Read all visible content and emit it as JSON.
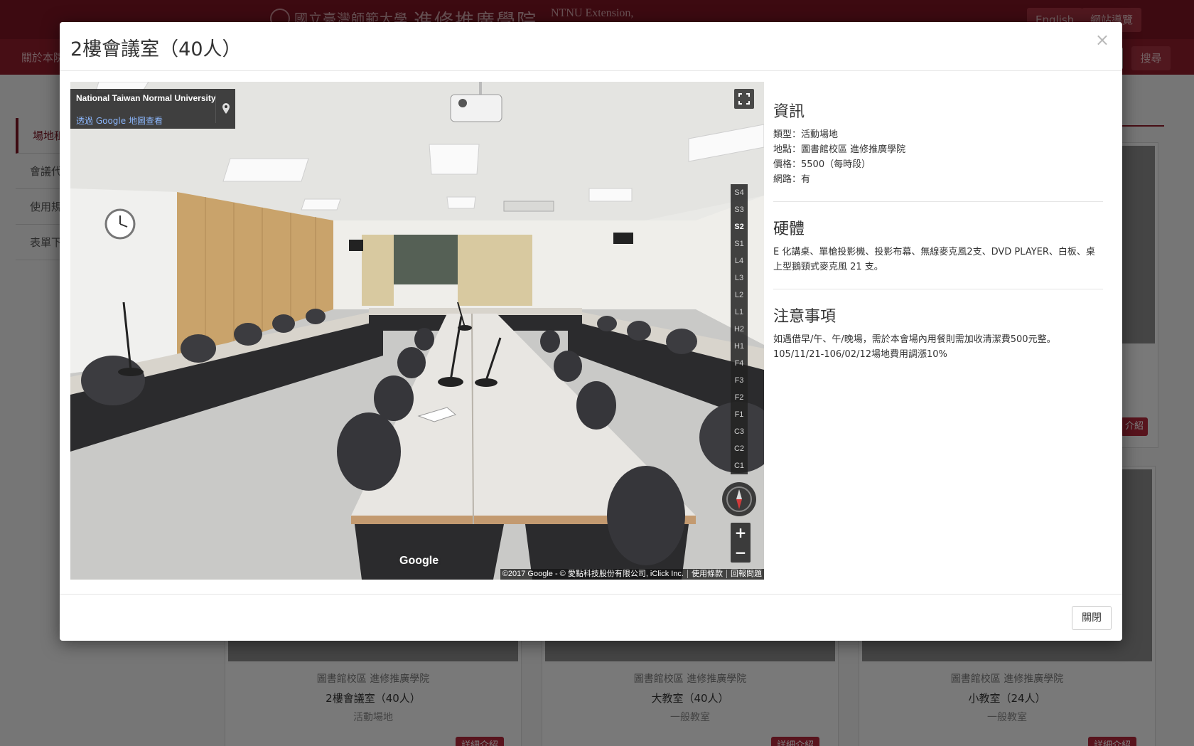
{
  "header": {
    "college_name": "進修推廣學院",
    "college_en": "NTNU Extension,",
    "buttons": [
      "English",
      "網站導覽"
    ]
  },
  "navbar": {
    "first_item": "關於本院",
    "search_label": "搜尋"
  },
  "sidebar": {
    "items": [
      {
        "label": "場地租借"
      },
      {
        "label": "會議代辦"
      },
      {
        "label": "使用規則"
      },
      {
        "label": "表單下載"
      }
    ]
  },
  "cards": [
    {
      "campus": "圖書館校區 進修推廣學院",
      "name": "2樓會議室（40人）",
      "type": "活動場地",
      "detail": "詳細介紹"
    },
    {
      "campus": "圖書館校區 進修推廣學院",
      "name": "大教室（40人）",
      "type": "一般教室",
      "detail": "詳細介紹"
    },
    {
      "campus": "圖書館校區 進修推廣學院",
      "name": "小教室（24人）",
      "type": "一般教室",
      "detail": "詳細介紹"
    }
  ],
  "upper_card_detail": "介紹",
  "modal": {
    "title": "2樓會議室（40人）",
    "close_symbol": "×",
    "close_button": "關閉"
  },
  "streetview": {
    "place_name": "National Taiwan Normal University",
    "view_link": "透過 Google 地圖查看",
    "floors": [
      "S4",
      "S3",
      "S2",
      "S1",
      "L4",
      "L3",
      "L2",
      "L1",
      "H2",
      "H1",
      "F4",
      "F3",
      "F2",
      "F1",
      "C3",
      "C2",
      "C1"
    ],
    "current_floor": "S2",
    "zoom_in": "+",
    "zoom_out": "−",
    "google_logo": "Google",
    "attribution": "©2017 Google - © 愛點科技股份有限公司, iClick Inc.",
    "terms": "使用條款",
    "report": "回報問題"
  },
  "info": {
    "section1_title": "資訊",
    "type_line": "類型：活動場地",
    "location_line": "地點：圖書館校區 進修推廣學院",
    "price_line": "價格：5500（每時段）",
    "network_line": "網路：有",
    "section2_title": "硬體",
    "hardware": "E 化講桌、單槍投影機、投影布幕、無線麥克風2支、DVD PLAYER、白板、桌上型鵝頸式麥克風 21 支。",
    "section3_title": "注意事項",
    "note1": "如遇借早/午、午/晚場，需於本會場內用餐則需加收清潔費500元整。",
    "note2": "105/11/21-106/02/12場地費用調漲10%"
  }
}
